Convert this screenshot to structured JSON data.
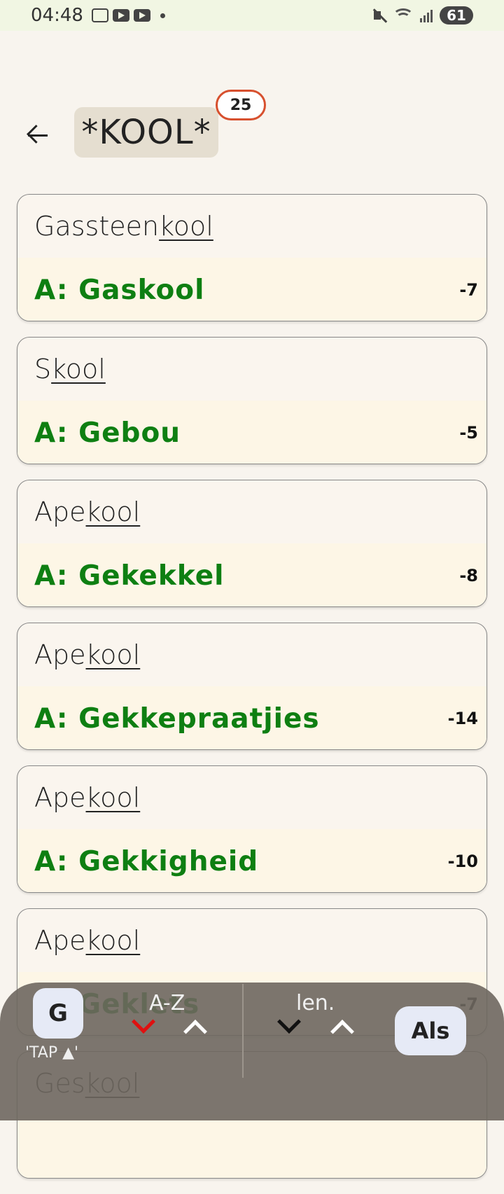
{
  "status_bar": {
    "time": "04:48",
    "battery": "61",
    "icons": [
      "screenshot-icon",
      "youtube-icon",
      "youtube-icon",
      "dot-icon",
      "mute-icon",
      "wifi-icon",
      "signal-icon",
      "battery-icon"
    ]
  },
  "header": {
    "query": "*KOOL*",
    "result_count": "25"
  },
  "cards": [
    {
      "prefix": "Gassteen",
      "match": "kool",
      "suffix": "",
      "answer": "A: Gaskool",
      "score": "-7"
    },
    {
      "prefix": "S",
      "match": "kool",
      "suffix": "",
      "answer": "A: Gebou",
      "score": "-5"
    },
    {
      "prefix": "Ape",
      "match": "kool",
      "suffix": "",
      "answer": "A: Gekekkel",
      "score": "-8"
    },
    {
      "prefix": "Ape",
      "match": "kool",
      "suffix": "",
      "answer": "A: Gekkepraatjies",
      "score": "-14"
    },
    {
      "prefix": "Ape",
      "match": "kool",
      "suffix": "",
      "answer": "A: Gekkigheid",
      "score": "-10"
    },
    {
      "prefix": "Ape",
      "match": "kool",
      "suffix": "",
      "answer": "A: Geklets",
      "score": "-7"
    },
    {
      "prefix": "Ges",
      "match": "kool",
      "suffix": "",
      "answer": "",
      "score": ""
    }
  ],
  "bottom_bar": {
    "g_button": "G",
    "tap_hint": "'TAP ▲'",
    "sort_az_label": "A-Z",
    "sort_len_label": "len.",
    "als_button": "Als",
    "colors": {
      "active_chevron": "#e01010",
      "inactive_chevron_dark": "#111111",
      "inactive_chevron_light": "#ffffff"
    }
  }
}
